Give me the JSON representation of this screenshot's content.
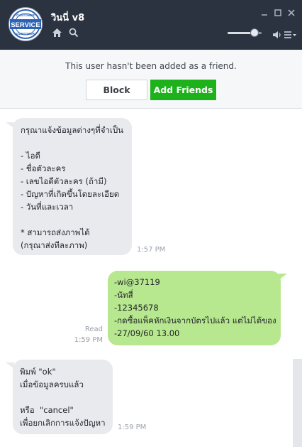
{
  "header": {
    "title": "วินนี่ v8",
    "avatar_text_top": "CUSTOMER",
    "avatar_text_mid": "SERVICE",
    "avatar_text_bottom": "CUSTOMER",
    "icons": [
      "home-icon",
      "search-icon",
      "minimize-icon",
      "maximize-icon",
      "close-icon",
      "volume-icon",
      "menu-icon"
    ],
    "volume_level": 0.8
  },
  "friend_bar": {
    "notice": "This user hasn't been added as a friend.",
    "block_label": "Block",
    "add_label": "Add Friends",
    "add_color": "#1db21b"
  },
  "messages": [
    {
      "direction": "incoming",
      "text": "กรุณาแจ้งข้อมูลต่างๆที่จำเป็น\n\n- ไอดี\n- ชื่อตัวละคร\n- เลขไอดีตัวละคร (ถ้ามี)\n- ปัญหาที่เกิดขึ้นโดยละเอียด\n- วันที่และเวลา\n\n* สามารถส่งภาพได้\n(กรุณาส่งทีละภาพ)",
      "time": "1:57 PM"
    },
    {
      "direction": "outgoing",
      "text": "-wi@37119\n-นัทสี่\n-12345678\n-กดซื้อแพ็คหักเงินจากบัตรไปแล้ว แต่ไม่ได้ของ\n-27/09/60 13.00",
      "read": "Read",
      "time": "1:59 PM"
    },
    {
      "direction": "incoming",
      "text": "พิมพ์ \"ok\"\nเมื่อข้อมูลครบแล้ว\n\nหรือ  \"cancel\"\nเพื่อยกเลิกการแจ้งปัญหา",
      "time": "1:59 PM"
    }
  ],
  "colors": {
    "header_bg": "#2c3340",
    "incoming_bubble": "#e8eaee",
    "outgoing_bubble": "#b7e78e"
  }
}
